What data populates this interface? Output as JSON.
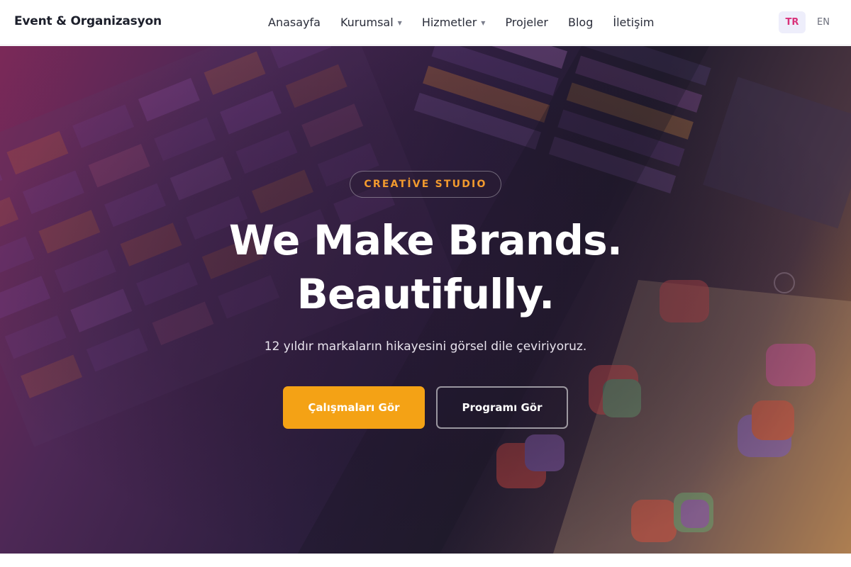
{
  "nav": {
    "brand": "Event & Organizasyon",
    "items": [
      {
        "label": "Anasayfa",
        "has_dropdown": false
      },
      {
        "label": "Kurumsal",
        "has_dropdown": true
      },
      {
        "label": "Hizmetler",
        "has_dropdown": true
      },
      {
        "label": "Projeler",
        "has_dropdown": false
      },
      {
        "label": "Blog",
        "has_dropdown": false
      },
      {
        "label": "İletişim",
        "has_dropdown": false
      }
    ],
    "caret_icon": "chevron-down-icon",
    "languages": [
      {
        "code": "TR",
        "active": true
      },
      {
        "code": "EN",
        "active": false
      }
    ]
  },
  "hero": {
    "eyebrow": "CREATİVE STUDIO",
    "title_line1": "We Make Brands.",
    "title_line2": "Beautifully.",
    "subtitle": "12 yıldır markaların hikayesini görsel dile çeviriyoruz.",
    "primary_button": "Çalışmaları Gör",
    "secondary_button": "Programı Gör"
  },
  "colors": {
    "accent": "#f4a215",
    "eyebrow_text": "#f29a2e",
    "active_lang_text": "#d9327a",
    "active_lang_bg": "#eeeefb"
  }
}
